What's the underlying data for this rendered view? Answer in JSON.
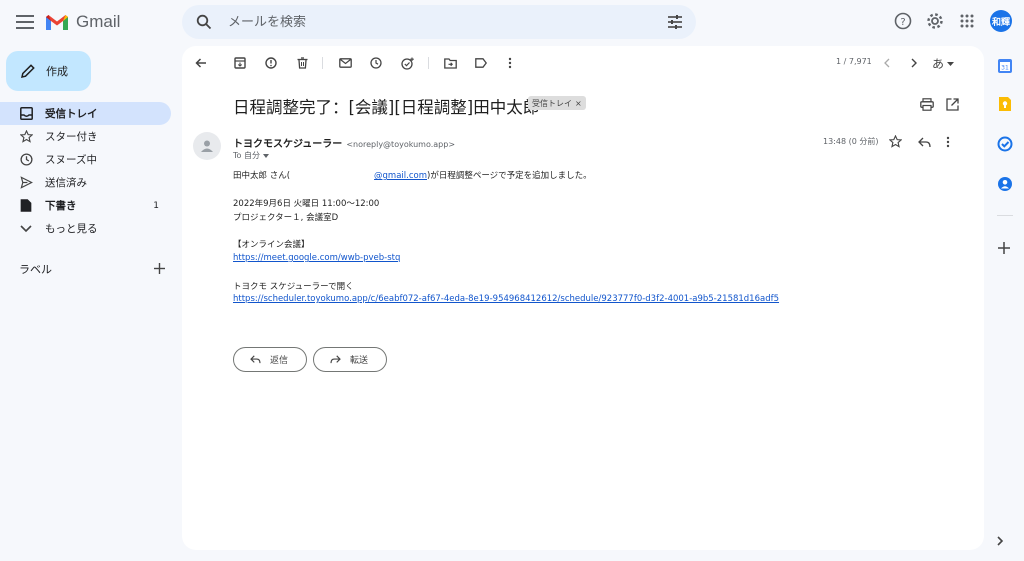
{
  "app": {
    "name": "Gmail"
  },
  "search": {
    "placeholder": "メールを検索"
  },
  "account": {
    "avatar_text": "和輝"
  },
  "compose": {
    "label": "作成"
  },
  "nav": [
    {
      "label": "受信トレイ",
      "icon": "inbox-icon",
      "count": ""
    },
    {
      "label": "スター付き",
      "icon": "star-icon",
      "count": ""
    },
    {
      "label": "スヌーズ中",
      "icon": "clock-icon",
      "count": ""
    },
    {
      "label": "送信済み",
      "icon": "send-icon",
      "count": ""
    },
    {
      "label": "下書き",
      "icon": "draft-icon",
      "count": "1"
    },
    {
      "label": "もっと見る",
      "icon": "chevron-down-icon",
      "count": ""
    }
  ],
  "labels": {
    "heading": "ラベル"
  },
  "toolbar": {
    "pager": "1 / 7,971",
    "input_tool": "あ"
  },
  "email": {
    "subject": "日程調整完了：[会議][日程調整]田中太郎",
    "label_chip": "受信トレイ",
    "label_chip_close": "×",
    "sender_name": "トヨクモスケジューラー",
    "sender_email": "<noreply@toyokumo.app>",
    "to": "To 自分",
    "time": "13:48 (0 分前)",
    "body": {
      "greeting_prefix": "田中太郎 さん(",
      "greeting_link": "@gmail.com",
      "greeting_suffix": ")が日程調整ページで予定を追加しました。",
      "datetime": "2022年9月6日 火曜日 11:00〜12:00",
      "location": "プロジェクター１, 会議室D",
      "online_heading": "【オンライン会議】",
      "meet_link": "https://meet.google.com/wwb-pveb-stq",
      "open_heading": "トヨクモ スケジューラーで開く",
      "scheduler_link": "https://scheduler.toyokumo.app/c/6eabf072-af67-4eda-8e19-954968412612/schedule/923777f0-d3f2-4001-a9b5-21581d16adf5"
    },
    "reply_label": "返信",
    "forward_label": "転送"
  },
  "colors": {
    "background": "#f6f8fc",
    "compose": "#c2e7ff",
    "active_nav": "#d3e3fd",
    "link": "#1155cc",
    "avatar": "#1a73e8"
  }
}
